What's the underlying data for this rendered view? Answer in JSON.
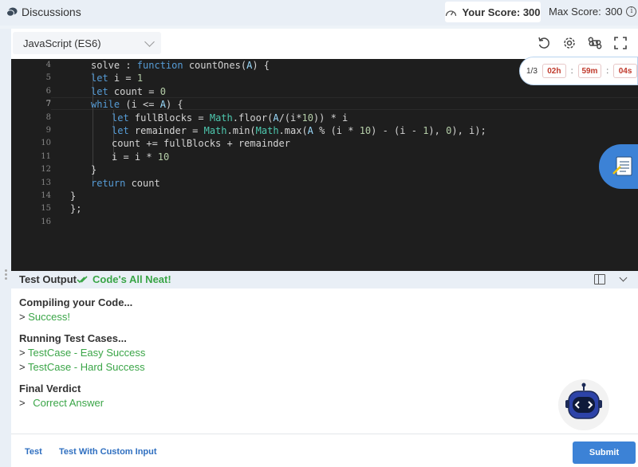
{
  "topbar": {
    "discussions_label": "Discussions",
    "your_score_label": "Your Score: 300",
    "max_score_label": "Max Score:",
    "max_score_value": "300"
  },
  "toolbar": {
    "language": "JavaScript (ES6)",
    "icons": [
      "reset-icon",
      "settings-icon",
      "command-icon",
      "fullscreen-icon"
    ]
  },
  "timer": {
    "question_index": "1/3",
    "hours": "02h",
    "minutes": "59m",
    "seconds": "04s"
  },
  "editor": {
    "lines": [
      {
        "n": "4",
        "indent": 1,
        "text": "solve : function countOnes(A) {"
      },
      {
        "n": "5",
        "indent": 1,
        "text": "let i = 1"
      },
      {
        "n": "6",
        "indent": 1,
        "text": "let count = 0"
      },
      {
        "n": "7",
        "indent": 1,
        "text": "while (i <= A) {"
      },
      {
        "n": "8",
        "indent": 2,
        "text": "let fullBlocks = Math.floor(A/(i*10)) * i"
      },
      {
        "n": "9",
        "indent": 2,
        "text": "let remainder = Math.min(Math.max(A % (i * 10) - (i - 1), 0), i);"
      },
      {
        "n": "10",
        "indent": 2,
        "text": "count += fullBlocks + remainder"
      },
      {
        "n": "11",
        "indent": 2,
        "text": "i = i * 10"
      },
      {
        "n": "12",
        "indent": 1,
        "text": "}"
      },
      {
        "n": "13",
        "indent": 1,
        "text": "return count"
      },
      {
        "n": "14",
        "indent": 0,
        "text": "}"
      },
      {
        "n": "15",
        "indent": 0,
        "text": "};"
      },
      {
        "n": "16",
        "indent": 0,
        "text": ""
      }
    ]
  },
  "output": {
    "title": "Test Output",
    "status": "Code's All Neat!",
    "compiling_heading": "Compiling your Code...",
    "compiling_result": "Success!",
    "running_heading": "Running Test Cases...",
    "test_cases": [
      "TestCase - Easy Success",
      "TestCase - Hard Success"
    ],
    "verdict_heading": "Final Verdict",
    "verdict": "Correct Answer",
    "prompt_symbol": ">"
  },
  "footer": {
    "test_label": "Test",
    "custom_label": "Test With Custom Input",
    "submit_label": "Submit"
  },
  "colors": {
    "accent": "#3c82d6",
    "success": "#3aa547",
    "timer_red": "#c0392b",
    "editor_bg": "#1e1e1e"
  }
}
